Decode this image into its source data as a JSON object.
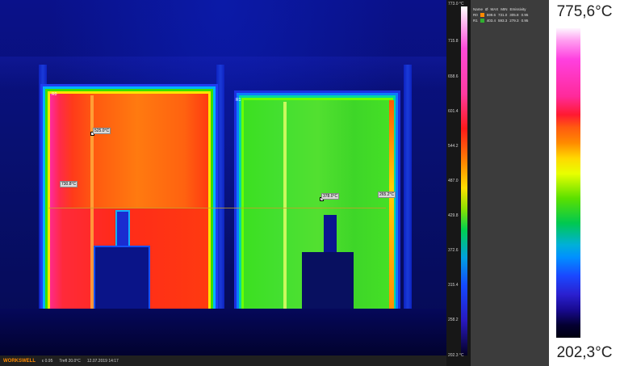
{
  "thermal": {
    "region_left": "R0",
    "region_right": "R1",
    "spot_labels": [
      "525.0°C",
      "730.8°C",
      "378.0°C",
      "265.2°C"
    ]
  },
  "statusbar": {
    "logo": "WORKSWELL",
    "emissivity": "ε 0.95",
    "treflected": "Trefl 20.0°C",
    "datetime": "12.07.2019 14:17"
  },
  "scale": {
    "max_label": "773.0 °C",
    "ticks": [
      "715.8",
      "658.6",
      "601.4",
      "544.2",
      "487.0",
      "429.8",
      "372.6",
      "315.4",
      "258.2"
    ],
    "min_label": "202.3 °C"
  },
  "table": {
    "headers": [
      "Name",
      "Ø",
      "MAX",
      "MIN",
      "Emissivity"
    ],
    "rows": [
      {
        "name": "R0",
        "color": "#ff8a00",
        "avg": "599.6",
        "max": "731.0",
        "min": "305.8",
        "emissivity": "0.95"
      },
      {
        "name": "R1",
        "color": "#30b030",
        "avg": "403.4",
        "max": "593.3",
        "min": "279.3",
        "emissivity": "0.95"
      }
    ]
  },
  "legend": {
    "max": "775,6°C",
    "min": "202,3°C"
  }
}
